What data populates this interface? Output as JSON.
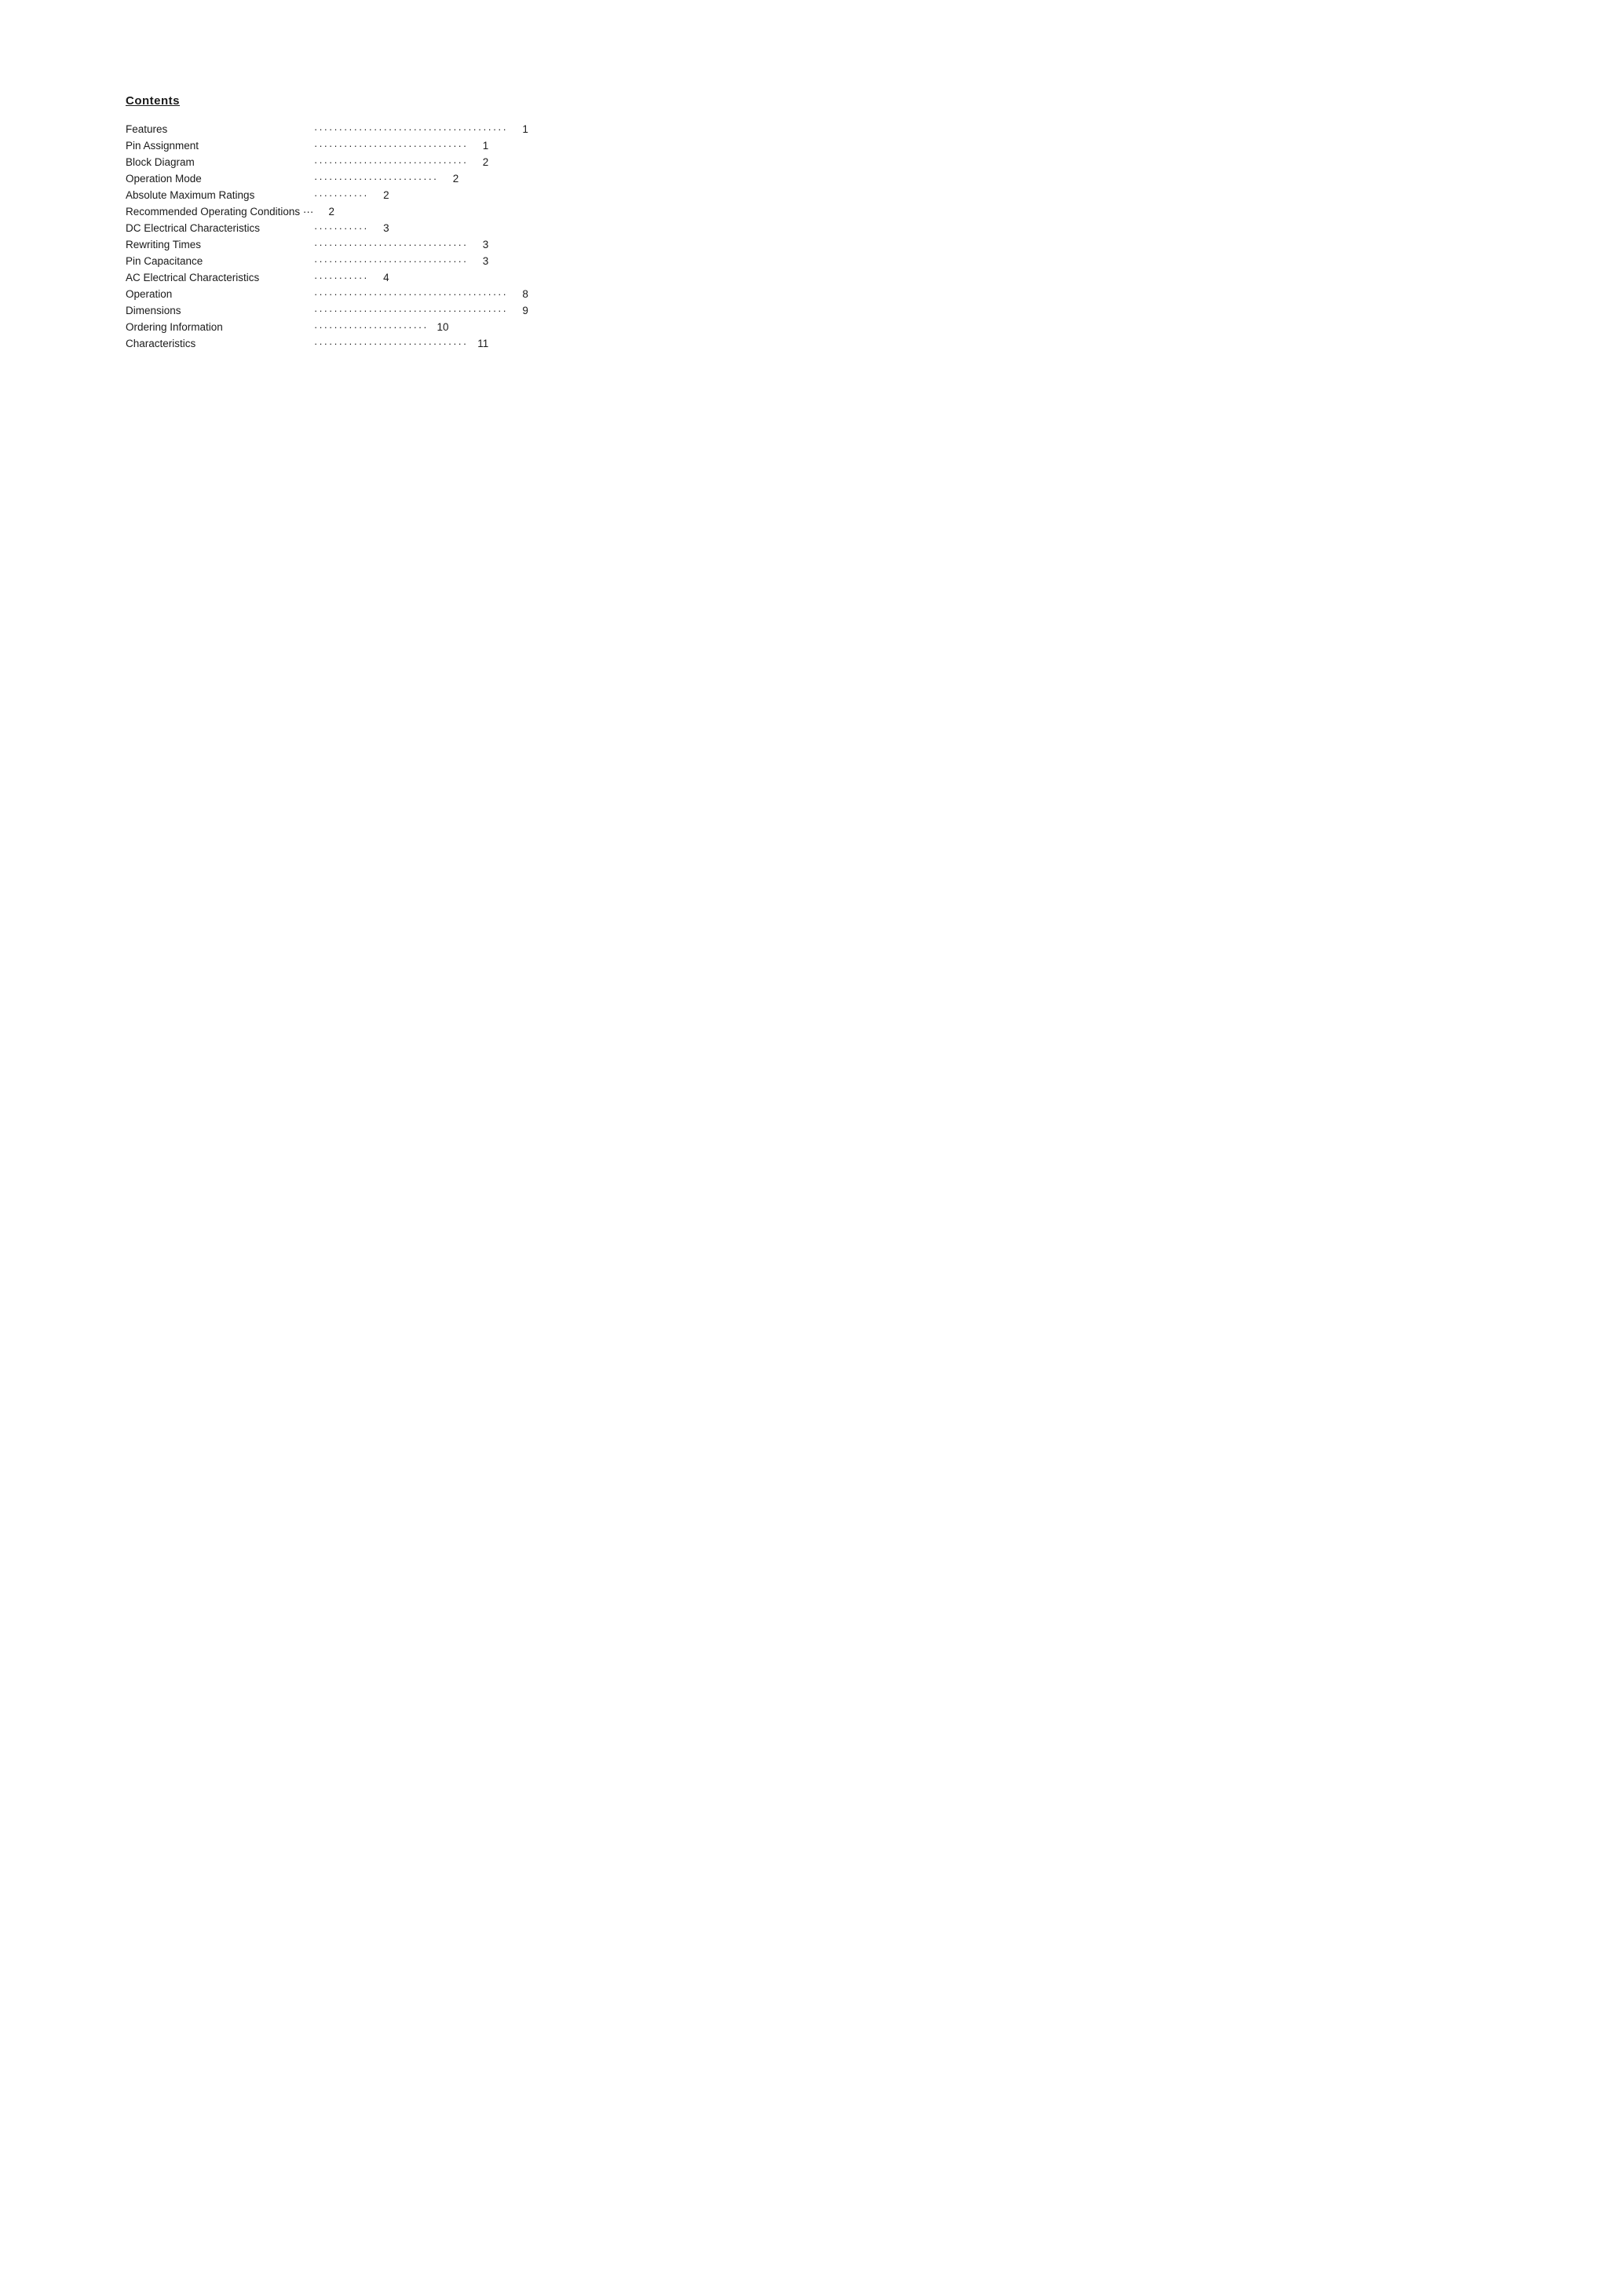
{
  "page": {
    "title": "Contents",
    "items": [
      {
        "label": "Features",
        "dots": "·······································",
        "page": "1"
      },
      {
        "label": "Pin Assignment",
        "dots": "·······························",
        "page": "1"
      },
      {
        "label": "Block Diagram",
        "dots": "·······························",
        "page": "2"
      },
      {
        "label": "Operation Mode",
        "dots": "·························",
        "page": "2"
      },
      {
        "label": "Absolute Maximum Ratings",
        "dots": "···········",
        "page": "2"
      },
      {
        "label": "Recommended Operating Conditions ···",
        "dots": "",
        "page": "2"
      },
      {
        "label": "DC Electrical Characteristics",
        "dots": "···········",
        "page": "3"
      },
      {
        "label": "Rewriting Times",
        "dots": "·······························",
        "page": "3"
      },
      {
        "label": "Pin Capacitance",
        "dots": "·······························",
        "page": "3"
      },
      {
        "label": "AC Electrical Characteristics",
        "dots": "···········",
        "page": "4"
      },
      {
        "label": "Operation",
        "dots": "·······································",
        "page": "8"
      },
      {
        "label": "Dimensions",
        "dots": "·······································",
        "page": "9"
      },
      {
        "label": "Ordering Information",
        "dots": "·······················",
        "page": "10"
      },
      {
        "label": "Characteristics",
        "dots": "·······························",
        "page": "11"
      }
    ]
  }
}
